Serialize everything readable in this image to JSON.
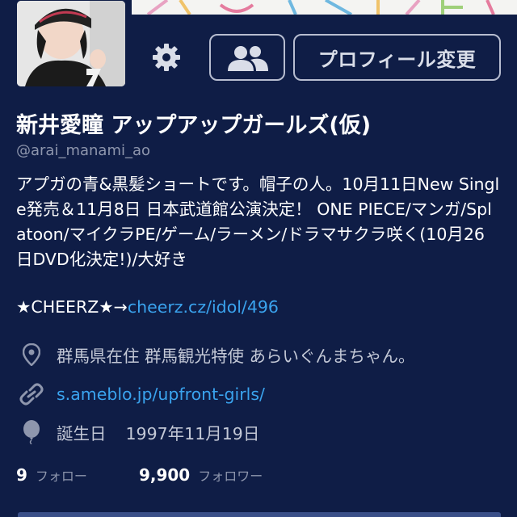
{
  "profile": {
    "display_name": "新井愛瞳 アップアップガールズ(仮)",
    "handle": "@arai_manami_ao",
    "bio": "アプガの青&黒髪ショートです。帽子の人。10月11日New Single発売＆11月8日 日本武道館公演決定！ ONE PIECE/マンガ/Splatoon/マイクラPE/ゲーム/ラーメン/ドラマサクラ咲く(10月26日DVD化決定!)/大好き",
    "cheerz_prefix": "★CHEERZ★→",
    "cheerz_link": "cheerz.cz/idol/496",
    "location": "群馬県在住 群馬観光特使 あらいぐんまちゃん。",
    "url": "s.ameblo.jp/upfront-girls/",
    "birthday_label": "誕生日",
    "birthday_value": "1997年11月19日"
  },
  "buttons": {
    "edit_profile": "プロフィール変更"
  },
  "stats": {
    "following_count": "9",
    "following_label": "フォロー",
    "followers_count": "9,900",
    "followers_label": "フォロワー"
  },
  "icons": {
    "settings": "gear-icon",
    "people": "people-icon",
    "location": "location-pin-icon",
    "url": "link-icon",
    "birthday": "balloon-icon"
  },
  "colors": {
    "background": "#0f1d46",
    "link": "#3aa3ee",
    "muted": "#8e96ad",
    "button_border": "#b7bdd0"
  }
}
